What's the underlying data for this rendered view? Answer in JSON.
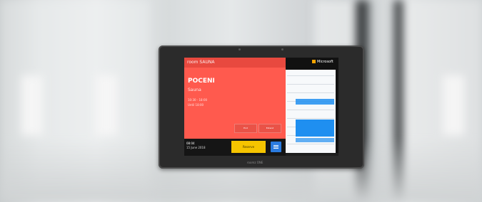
{
  "device": {
    "room_name": "room SAUNA",
    "status": "POCENI",
    "subject": "Sauna",
    "time_line1": "10:30 - 18:00",
    "time_line2": "Until 18:00",
    "action1": "End",
    "action2": "Extend",
    "clock": "08:04",
    "date": "15 June 2018",
    "reserve_label": "Reserve",
    "brand": "Microsoft",
    "device_brand": "roomz ONE"
  },
  "colors": {
    "busy_red": "#ff5a4e",
    "reserve_yellow": "#f5c400",
    "event_blue": "#1f8ff0"
  }
}
